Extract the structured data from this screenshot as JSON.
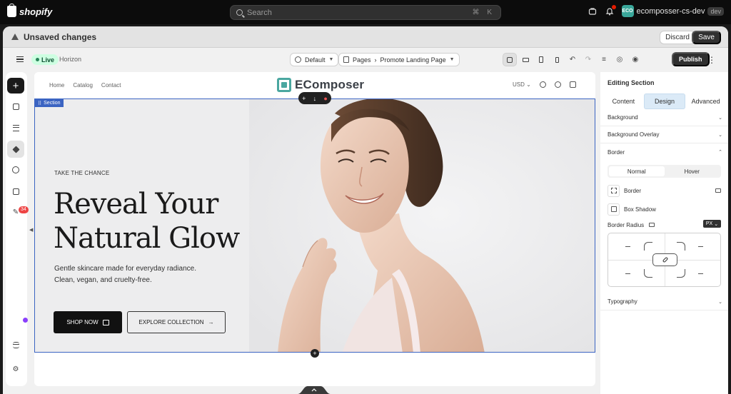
{
  "topbar": {
    "brand": "shopify",
    "search_placeholder": "Search",
    "search_shortcut": "⌘ K",
    "store_initials": "ECO",
    "store_name": "ecomposser-cs-dev",
    "store_badge": "dev"
  },
  "unsaved_bar": {
    "message": "Unsaved changes",
    "discard_label": "Discard",
    "save_label": "Save"
  },
  "toolbar": {
    "status": "Live",
    "theme_name": "Horizon",
    "template_select": "Default",
    "pages_label": "Pages",
    "breadcrumb_sep": "›",
    "page_name": "Promote Landing Page",
    "publish_label": "Publish"
  },
  "leftbar": {
    "add_label": "+",
    "notification_count": "34"
  },
  "site": {
    "nav_links": [
      "Home",
      "Catalog",
      "Contact"
    ],
    "brand_name": "EComposer",
    "currency": "USD"
  },
  "section": {
    "tag": "Section",
    "tools": [
      "+",
      "↓",
      "🗑"
    ]
  },
  "hero": {
    "eyebrow": "TAKE THE CHANCE",
    "title_line1": "Reveal Your",
    "title_line2": "Natural Glow",
    "subtitle_line1": "Gentle skincare made for everyday radiance.",
    "subtitle_line2": "Clean, vegan, and cruelty-free.",
    "primary_cta": "SHOP NOW",
    "secondary_cta": "EXPLORE COLLECTION"
  },
  "panel": {
    "title": "Editing Section",
    "tabs": [
      "Content",
      "Design",
      "Advanced"
    ],
    "active_tab": "Design",
    "accordions": {
      "background": "Background",
      "background_overlay": "Background Overlay",
      "border": "Border",
      "typography": "Typography"
    },
    "border": {
      "states": [
        "Normal",
        "Hover"
      ],
      "active_state": "Normal",
      "border_label": "Border",
      "box_shadow_label": "Box Shadow",
      "radius_label": "Border Radius",
      "unit": "PX",
      "radius_values": [
        "—",
        "—",
        "—",
        "—"
      ]
    }
  },
  "colors": {
    "accent_blue": "#3b64c2",
    "live_green": "#29845a",
    "design_tab_bg": "#dbeaf7",
    "danger": "#d72c0d"
  }
}
